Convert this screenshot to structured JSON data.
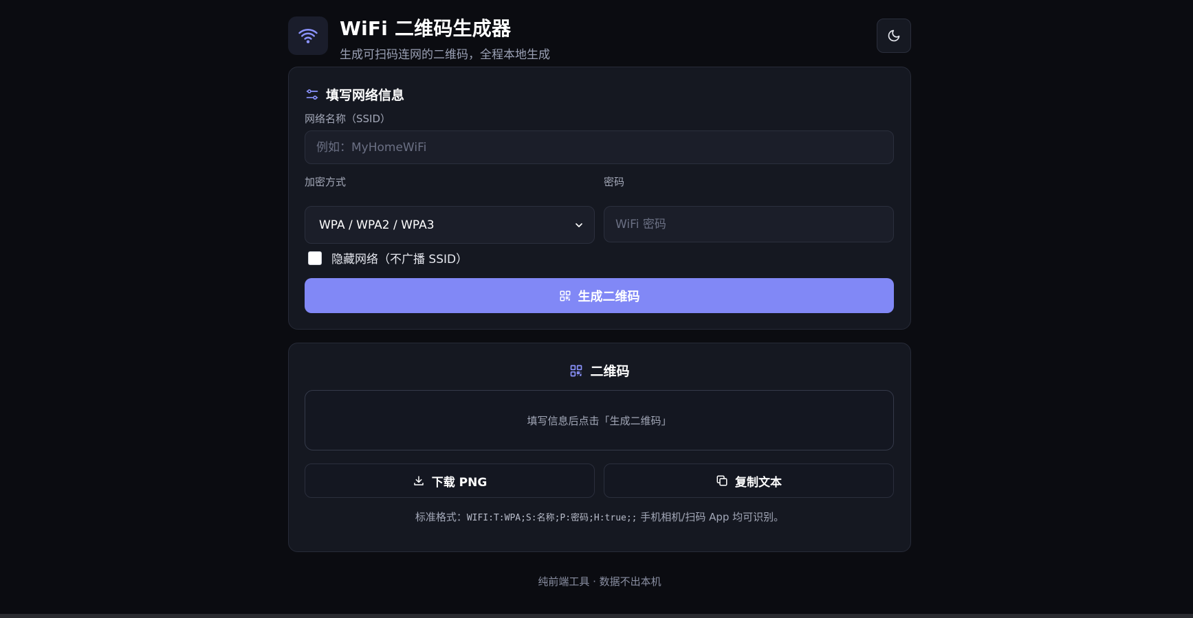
{
  "header": {
    "title": "WiFi 二维码生成器",
    "subtitle": "生成可扫码连网的二维码，全程本地生成",
    "logo_icon": "wifi-icon",
    "theme_icon": "moon-icon"
  },
  "form": {
    "section_title": "填写网络信息",
    "section_icon": "sliders-icon",
    "ssid": {
      "label": "网络名称（SSID）",
      "placeholder": "例如：MyHomeWiFi",
      "value": ""
    },
    "encryption": {
      "label": "加密方式",
      "selected": "WPA / WPA2 / WPA3"
    },
    "password": {
      "label": "密码",
      "placeholder": "WiFi 密码",
      "value": ""
    },
    "hidden": {
      "label": "隐藏网络（不广播 SSID）",
      "checked": false
    },
    "generate_label": "生成二维码"
  },
  "qr": {
    "section_title": "二维码",
    "placeholder_text": "填写信息后点击「生成二维码」",
    "download_label": "下载 PNG",
    "copy_label": "复制文本",
    "hint_prefix": "标准格式：",
    "hint_code": "WIFI:T:WPA;S:名称;P:密码;H:true;;",
    "hint_suffix": " 手机相机/扫码 App 均可识别。"
  },
  "footer": {
    "text": "纯前端工具 · 数据不出本机"
  },
  "colors": {
    "accent": "#8188f6",
    "background": "#0b0c11",
    "card": "#151821"
  }
}
